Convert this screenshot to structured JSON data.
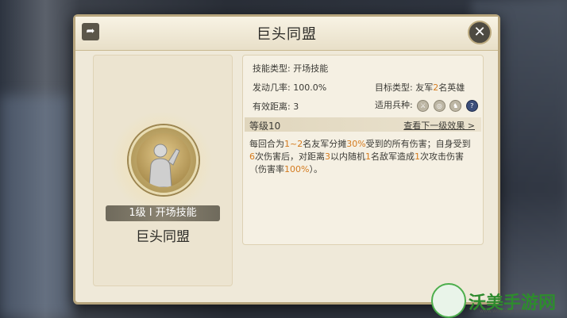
{
  "dialog": {
    "title": "巨头同盟",
    "share_icon": "share-icon",
    "close_icon": "close-icon"
  },
  "skill": {
    "level_badge": "1级 I 开场技能",
    "name": "巨头同盟"
  },
  "attributes": {
    "type_label": "技能类型:",
    "type_value": "开场技能",
    "rate_label": "发动几率:",
    "rate_value": "100.0%",
    "target_label": "目标类型:",
    "target_value_pre": "友军",
    "target_value_num": "2",
    "target_value_post": "名英雄",
    "range_label": "有效距离:",
    "range_value": "3",
    "troop_label": "适用兵种:",
    "troops": [
      "sword-icon",
      "bow-icon",
      "cavalry-icon",
      "question-icon"
    ]
  },
  "level_section": {
    "level": "等级10",
    "next_link": "查看下一级效果 >"
  },
  "description": {
    "p1": "每回合为",
    "n1": "1~2",
    "p2": "名友军分摊",
    "n2": "30%",
    "p3": "受到的所有伤害；自身受到",
    "n3": "6",
    "p4": "次伤害后，对距离",
    "n4": "3",
    "p5": "以内随机",
    "n5": "1",
    "p6": "名敌军造成",
    "n6": "1",
    "p7": "次攻击伤害（伤害率",
    "n7": "100%",
    "p8": "）。"
  },
  "watermark": {
    "text": "沃美手游网",
    "url": "www.womeigd.com"
  }
}
